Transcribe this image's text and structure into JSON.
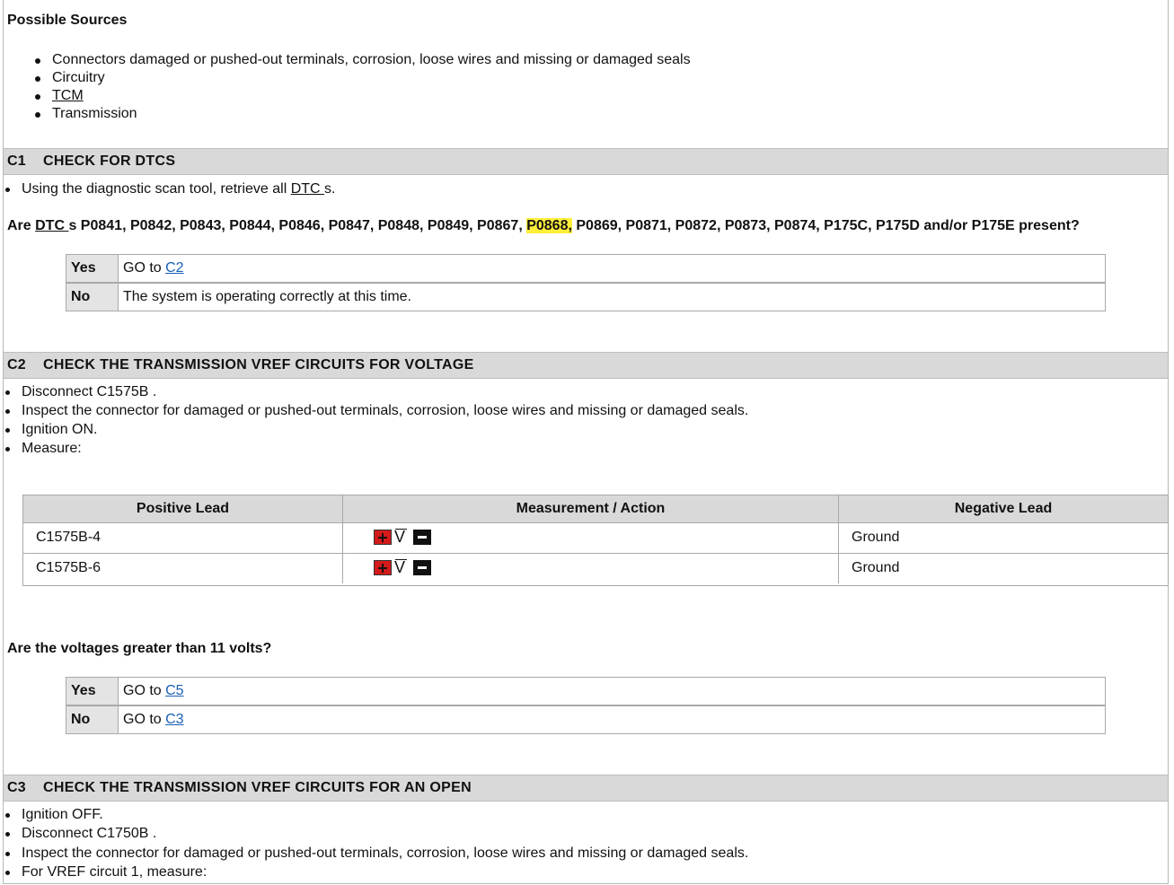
{
  "possible_sources": {
    "heading": "Possible Sources",
    "items": [
      "Connectors damaged or pushed-out terminals, corrosion, loose wires and missing or damaged seals",
      "Circuitry",
      "TCM",
      "Transmission"
    ]
  },
  "c1": {
    "code": "C1",
    "title": "CHECK FOR DTCS",
    "bullet_pre": "Using the diagnostic scan tool, retrieve all ",
    "bullet_link": "DTC ",
    "bullet_post": "s.",
    "question_pre": "Are ",
    "question_link": "DTC ",
    "question_mid": "s P0841, P0842, P0843, P0844, P0846, P0847, P0848, P0849, P0867, ",
    "question_highlight": "P0868,",
    "question_post": " P0869, P0871, P0872, P0873, P0874, P175C, P175D and/or P175E present?",
    "yes_label": "Yes",
    "yes_text": "GO to ",
    "yes_link": "C2",
    "no_label": "No",
    "no_text": "The system is operating correctly at this time."
  },
  "c2": {
    "code": "C2",
    "title": "CHECK THE TRANSMISSION VREF CIRCUITS FOR VOLTAGE",
    "bullets": [
      "Disconnect C1575B .",
      "Inspect the connector for damaged or pushed-out terminals, corrosion, loose wires and missing or damaged seals.",
      "Ignition ON.",
      "Measure:"
    ],
    "table": {
      "headers": [
        "Positive Lead",
        "Measurement / Action",
        "Negative Lead"
      ],
      "rows": [
        {
          "positive": "C1575B-4",
          "action": "voltmeter-symbol",
          "negative": "Ground"
        },
        {
          "positive": "C1575B-6",
          "action": "voltmeter-symbol",
          "negative": "Ground"
        }
      ]
    },
    "question": "Are the voltages greater than 11 volts?",
    "yes_label": "Yes",
    "yes_text": "GO to ",
    "yes_link": "C5",
    "no_label": "No",
    "no_text": "GO to ",
    "no_link": "C3"
  },
  "c3": {
    "code": "C3",
    "title": "CHECK THE TRANSMISSION VREF CIRCUITS FOR AN OPEN",
    "bullets": [
      "Ignition OFF.",
      "Disconnect C1750B .",
      "Inspect the connector for damaged or pushed-out terminals, corrosion, loose wires and missing or damaged seals.",
      "For VREF circuit 1, measure:"
    ]
  },
  "colors": {
    "highlight": "#ffef3a",
    "header_bar": "#d9d9d9",
    "link": "#1a5fb4",
    "plus_red": "#d41a1a"
  }
}
